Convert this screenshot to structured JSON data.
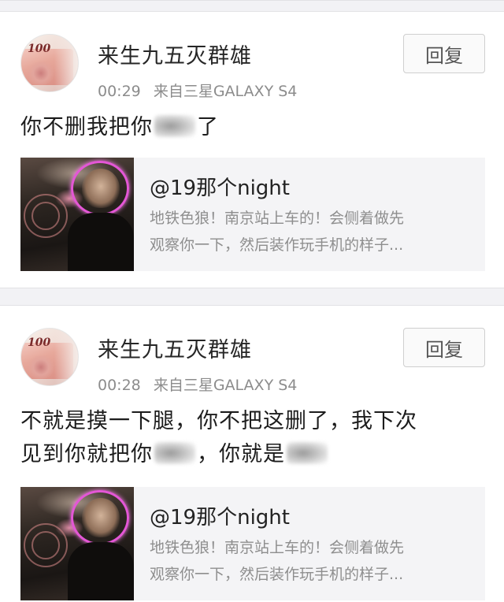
{
  "posts": [
    {
      "username": "来生九五灭群雄",
      "time": "00:29",
      "source": "来自三星GALAXY S4",
      "reply_label": "回复",
      "avatar_text": "100",
      "text_before": "你不删我把你",
      "text_after": "了",
      "quote": {
        "title": "@19那个night",
        "desc_line1": "地铁色狼！南京站上车的！会侧着做先",
        "desc_line2": "观察你一下，然后装作玩手机的样子..."
      }
    },
    {
      "username": "来生九五灭群雄",
      "time": "00:28",
      "source": "来自三星GALAXY S4",
      "reply_label": "回复",
      "avatar_text": "100",
      "text_line1": "不就是摸一下腿，你不把这删了，我下次",
      "text_line2_a": "见到你就把你",
      "text_line2_b": "，你就是",
      "quote": {
        "title": "@19那个night",
        "desc_line1": "地铁色狼！南京站上车的！会侧着做先",
        "desc_line2": "观察你一下，然后装作玩手机的样子..."
      }
    }
  ],
  "colors": {
    "background": "#f0f0f2",
    "card": "#ffffff",
    "quote_bg": "#f4f4f6",
    "meta_text": "#8c8c8c",
    "highlight_circle": "#e457d6"
  }
}
